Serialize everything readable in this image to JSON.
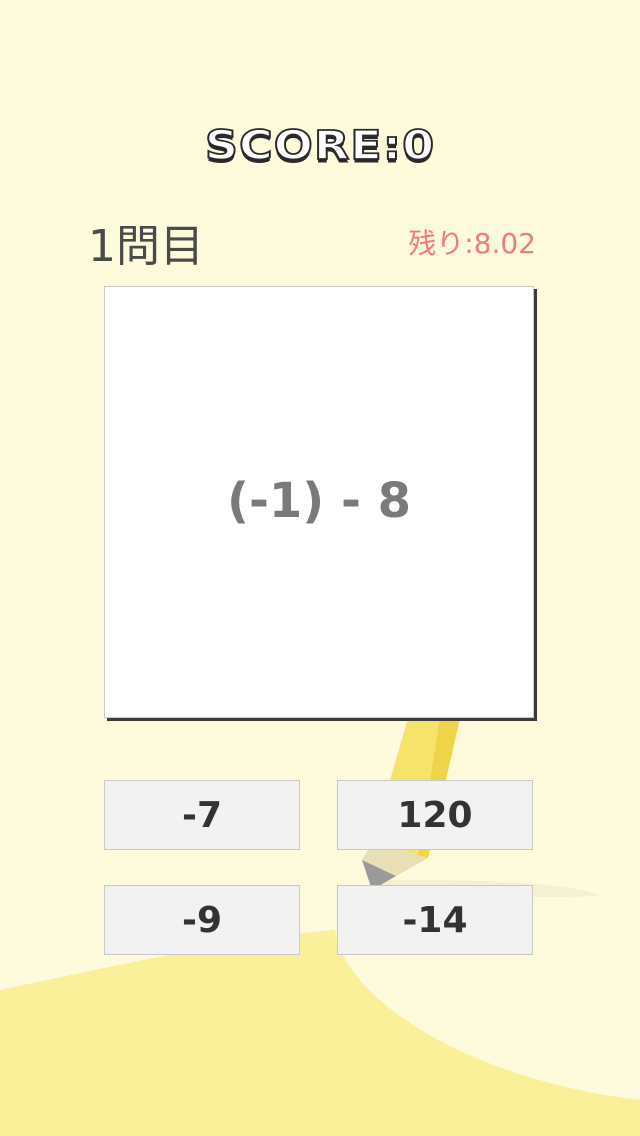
{
  "header": {
    "score_text": "SCORE:0",
    "question_number": "1問目",
    "timer": "残り:8.02"
  },
  "problem": {
    "expression": "(-1) - 8"
  },
  "answers": [
    {
      "label": "-7"
    },
    {
      "label": "120"
    },
    {
      "label": "-9"
    },
    {
      "label": "-14"
    }
  ],
  "colors": {
    "background": "#fdfbdc",
    "accent_yellow": "#faf09a",
    "timer_red": "#f27a7a"
  }
}
